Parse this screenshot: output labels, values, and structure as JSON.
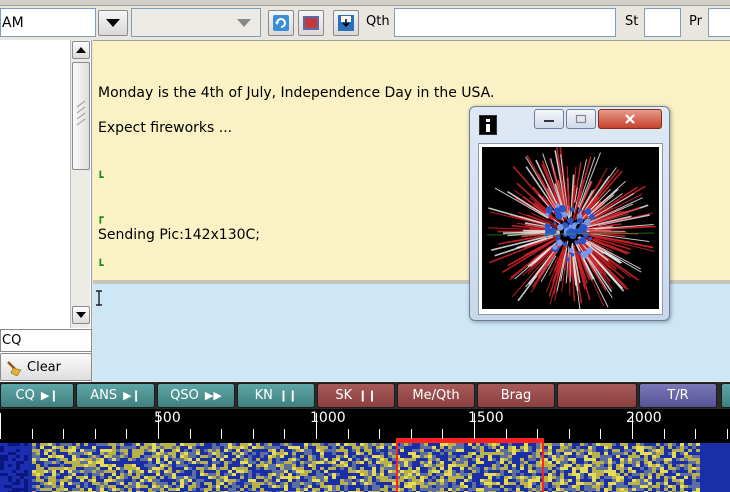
{
  "toolbar": {
    "mode_value": "AM",
    "qth_label": "Qth",
    "st_label": "St",
    "pr_label": "Pr"
  },
  "left_panel": {
    "macro_field_value": "CQ",
    "clear_label": "Clear"
  },
  "rx_text": {
    "line1": "Monday is the 4th of July, Independence Day in the USA.",
    "line2": "Expect fireworks ...",
    "line3": "Sending Pic:142x130C;"
  },
  "popup": {
    "title_icon": "info-icon",
    "minimize_icon": "minimize-icon",
    "maximize_icon": "maximize-icon",
    "close_icon": "close-icon"
  },
  "macros": [
    {
      "label": "CQ",
      "glyph": "▶❙",
      "color": "teal"
    },
    {
      "label": "ANS",
      "glyph": "▶❙",
      "color": "teal"
    },
    {
      "label": "QSO",
      "glyph": "▶▶",
      "color": "teal"
    },
    {
      "label": "KN",
      "glyph": "❙❙",
      "color": "teal"
    },
    {
      "label": "SK",
      "glyph": "❙❙",
      "color": "red"
    },
    {
      "label": "Me/Qth",
      "glyph": "",
      "color": "red"
    },
    {
      "label": "Brag",
      "glyph": "",
      "color": "red"
    },
    {
      "label": "",
      "glyph": "",
      "color": "red"
    },
    {
      "label": "T/R",
      "glyph": "",
      "color": "blue"
    }
  ],
  "scale": {
    "ticks": [
      "500",
      "1000",
      "1500",
      "2000"
    ]
  },
  "colors": {
    "rx_background": "#faf1c4",
    "tx_background": "#cde7f7",
    "bandwidth_marker": "#ff2020"
  }
}
